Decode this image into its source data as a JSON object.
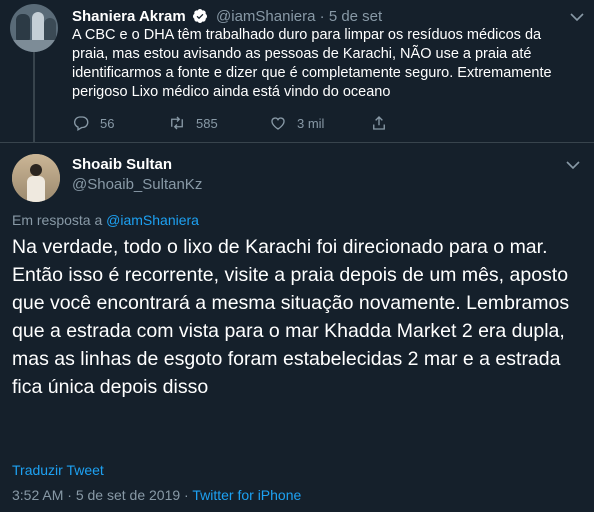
{
  "parent_tweet": {
    "name": "Shaniera Akram",
    "handle": "@iamShaniera",
    "separator": "·",
    "date": "5 de set",
    "text": "A CBC e o DHA têm trabalhado duro para limpar os resíduos médicos da praia, mas estou avisando as pessoas de Karachi, NÃO use a praia até identificarmos a fonte e dizer que é completamente seguro. Extremamente perigoso Lixo médico ainda está vindo do oceano",
    "replies": "56",
    "retweets": "585",
    "likes": "3 mil",
    "icons": [
      "reply-icon",
      "retweet-icon",
      "like-icon",
      "share-icon",
      "verified-icon",
      "chevron-down-icon"
    ]
  },
  "main_tweet": {
    "name": "Shoaib Sultan",
    "handle": "@Shoaib_SultanKz",
    "reply_prefix": "Em resposta a",
    "reply_to": "@iamShaniera",
    "text": "Na verdade, todo o lixo de Karachi foi direcionado para o mar. Então isso é recorrente, visite a praia depois de um mês, aposto que você encontrará a mesma situação novamente. Lembramos que a estrada com vista para o mar Khadda Market 2 era dupla, mas as linhas de esgoto foram estabelecidas 2 mar e a estrada fica única depois disso",
    "translate_label": "Traduzir Tweet",
    "time": "3:52 AM",
    "separator": "·",
    "date": "5 de set de 2019",
    "source": "Twitter for iPhone"
  },
  "colors": {
    "background": "#15202b",
    "accent": "#1da1f2",
    "secondary_text": "#8899a6",
    "divider": "#38444d"
  }
}
